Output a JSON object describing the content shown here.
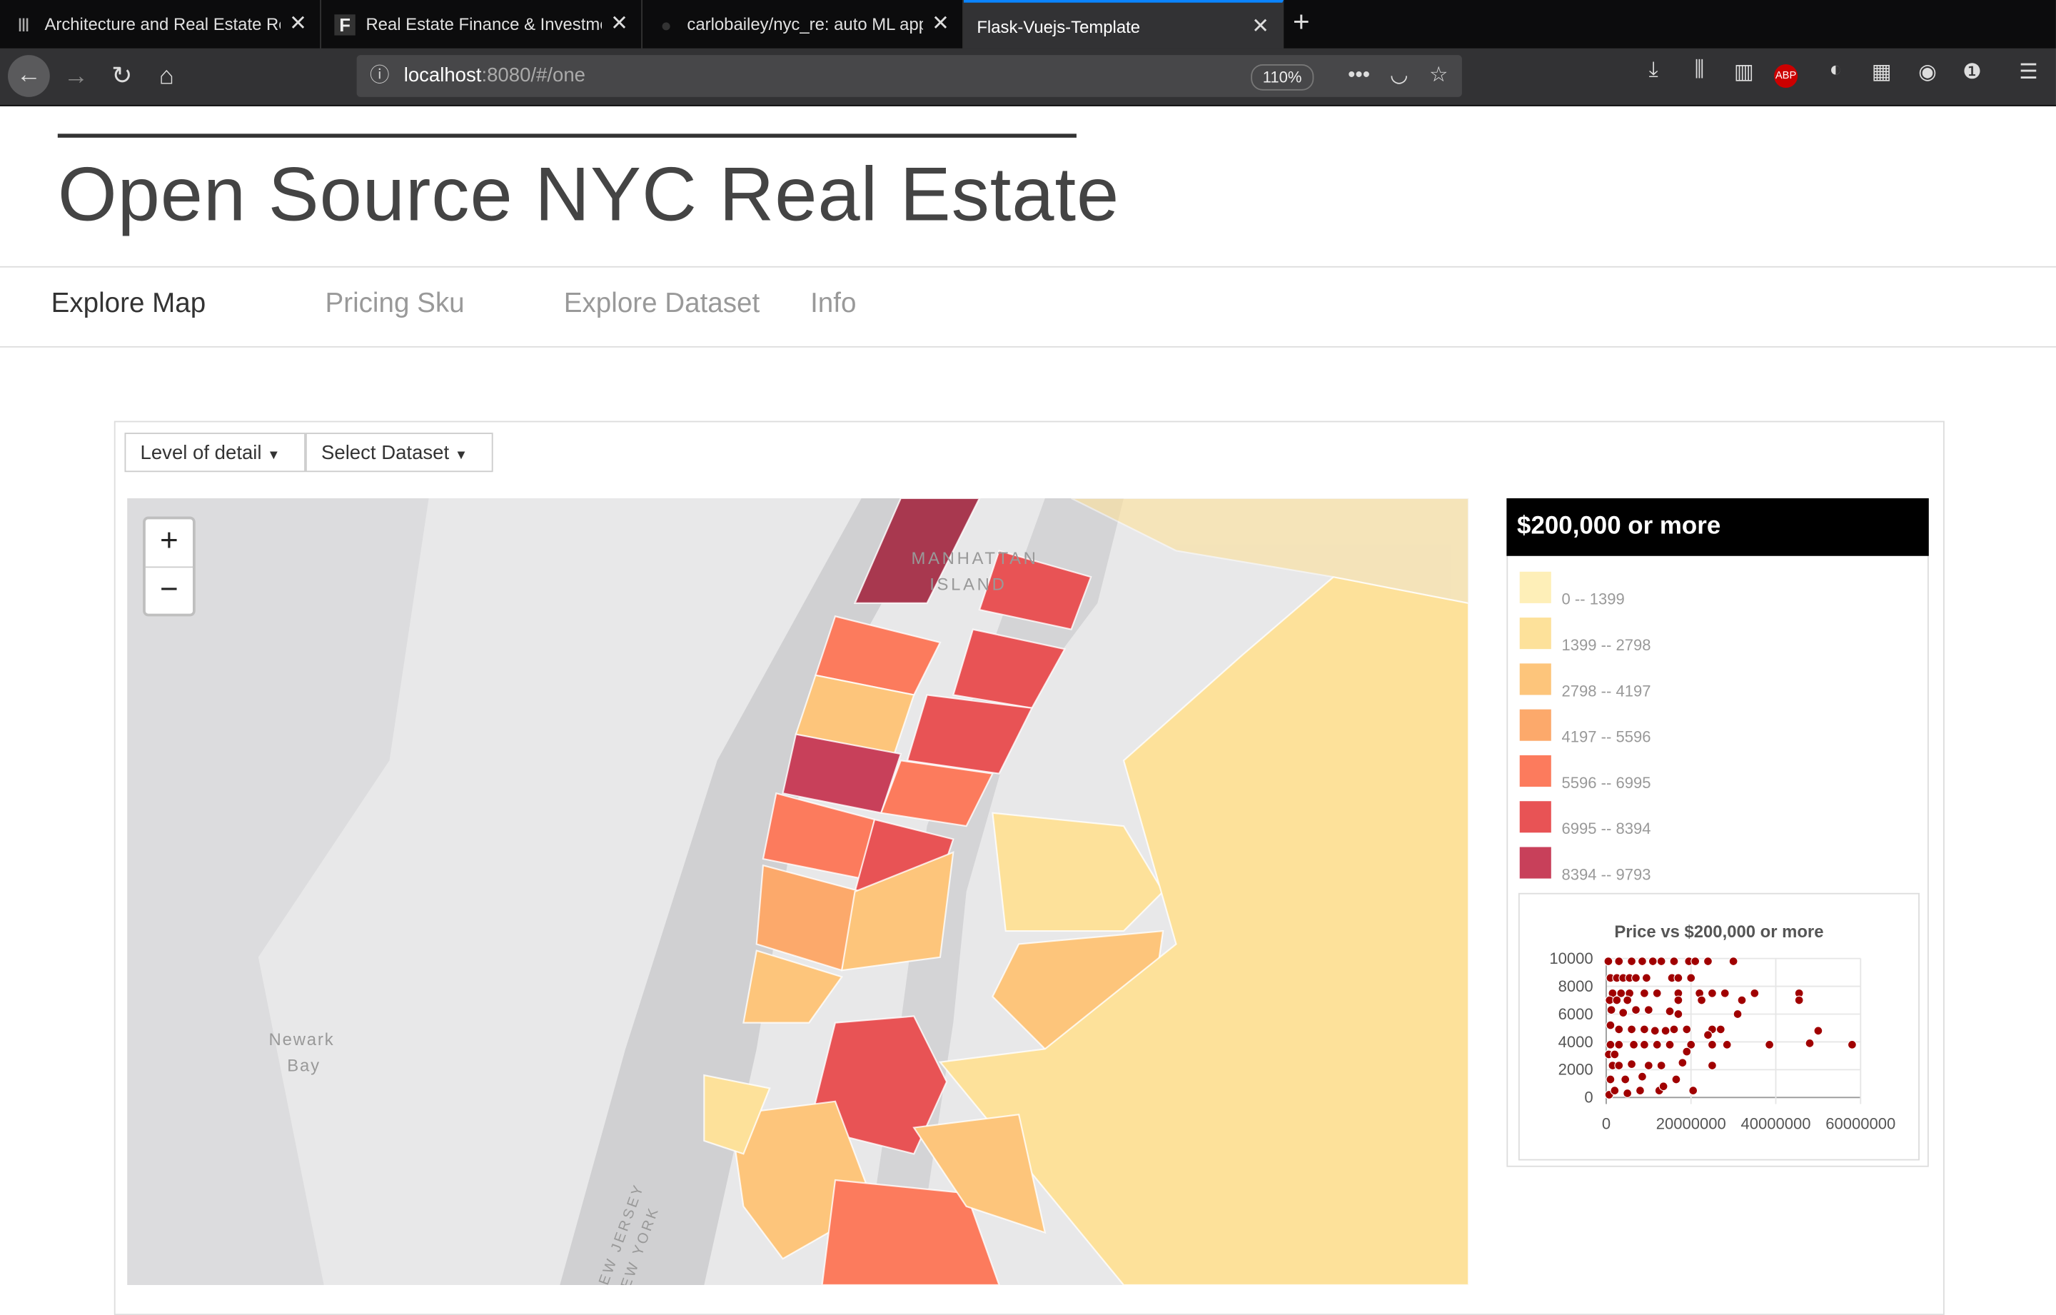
{
  "browser": {
    "tabs": [
      {
        "label": "Architecture and Real Estate Re",
        "icon": "hhh-icon"
      },
      {
        "label": "Real Estate Finance & Investme",
        "icon": "f-icon"
      },
      {
        "label": "carlobailey/nyc_re: auto ML app",
        "icon": "github-icon"
      },
      {
        "label": "Flask-Vuejs-Template",
        "icon": "none"
      }
    ],
    "url_host": "localhost",
    "url_rest": ":8080/#/one",
    "zoom": "110%"
  },
  "page": {
    "title": "Open Source NYC Real Estate",
    "nav": [
      "Explore Map",
      "Pricing Sku",
      "Explore Dataset",
      "Info"
    ],
    "dropdowns": [
      "Level of detail",
      "Select Dataset"
    ],
    "map_labels": {
      "manhattan1": "MANHATTAN",
      "manhattan2": "ISLAND",
      "newark1": "Newark",
      "newark2": "Bay",
      "nj": "NEW JERSEY",
      "ny": "NEW YORK"
    },
    "zoom_in": "+",
    "zoom_out": "−"
  },
  "legend": {
    "title": "$200,000 or more",
    "items": [
      {
        "label": "0 -- 1399",
        "color": "#feefb8"
      },
      {
        "label": "1399 -- 2798",
        "color": "#fde19a"
      },
      {
        "label": "2798 -- 4197",
        "color": "#fdc57b"
      },
      {
        "label": "4197 -- 5596",
        "color": "#fca96b"
      },
      {
        "label": "5596 -- 6995",
        "color": "#fc7b5d"
      },
      {
        "label": "6995 -- 8394",
        "color": "#e85355"
      },
      {
        "label": "8394 -- 9793",
        "color": "#c8405a"
      }
    ]
  },
  "chart_data": {
    "type": "scatter",
    "title": "Price vs $200,000 or more",
    "xlim": [
      0,
      60000000
    ],
    "ylim": [
      0,
      10000
    ],
    "xticks": [
      "0",
      "20000000",
      "40000000",
      "60000000"
    ],
    "yticks": [
      "0",
      "2000",
      "4000",
      "6000",
      "8000",
      "10000"
    ],
    "color": "#a00000",
    "points": [
      [
        500000,
        9800
      ],
      [
        3000000,
        9800
      ],
      [
        6000000,
        9800
      ],
      [
        8500000,
        9800
      ],
      [
        11000000,
        9800
      ],
      [
        13000000,
        9800
      ],
      [
        16000000,
        9800
      ],
      [
        19500000,
        9800
      ],
      [
        21000000,
        9800
      ],
      [
        24000000,
        9800
      ],
      [
        30000000,
        9800
      ],
      [
        1000000,
        8600
      ],
      [
        2500000,
        8600
      ],
      [
        4000000,
        8600
      ],
      [
        5500000,
        8600
      ],
      [
        7000000,
        8600
      ],
      [
        9500000,
        8600
      ],
      [
        15500000,
        8600
      ],
      [
        17000000,
        8600
      ],
      [
        20000000,
        8600
      ],
      [
        1500000,
        7500
      ],
      [
        3500000,
        7500
      ],
      [
        5500000,
        7500
      ],
      [
        9000000,
        7500
      ],
      [
        12000000,
        7500
      ],
      [
        17000000,
        7500
      ],
      [
        22000000,
        7500
      ],
      [
        25000000,
        7500
      ],
      [
        28000000,
        7500
      ],
      [
        35000000,
        7500
      ],
      [
        45500000,
        7500
      ],
      [
        800000,
        7000
      ],
      [
        2500000,
        7000
      ],
      [
        5000000,
        7000
      ],
      [
        17000000,
        7000
      ],
      [
        22500000,
        7000
      ],
      [
        32000000,
        7000
      ],
      [
        45500000,
        7000
      ],
      [
        1200000,
        6300
      ],
      [
        4000000,
        6100
      ],
      [
        7000000,
        6300
      ],
      [
        10000000,
        6300
      ],
      [
        15000000,
        6200
      ],
      [
        17000000,
        6000
      ],
      [
        31000000,
        6000
      ],
      [
        1000000,
        5200
      ],
      [
        3000000,
        4900
      ],
      [
        6000000,
        4900
      ],
      [
        9000000,
        4900
      ],
      [
        11500000,
        4800
      ],
      [
        14000000,
        4800
      ],
      [
        16000000,
        4900
      ],
      [
        19000000,
        4900
      ],
      [
        25000000,
        4900
      ],
      [
        27000000,
        4900
      ],
      [
        24000000,
        4500
      ],
      [
        50000000,
        4800
      ],
      [
        1000000,
        3800
      ],
      [
        3000000,
        3800
      ],
      [
        6500000,
        3800
      ],
      [
        9000000,
        3800
      ],
      [
        12000000,
        3800
      ],
      [
        15000000,
        3800
      ],
      [
        20000000,
        3800
      ],
      [
        25000000,
        3800
      ],
      [
        28500000,
        3800
      ],
      [
        38500000,
        3800
      ],
      [
        48000000,
        3900
      ],
      [
        58000000,
        3800
      ],
      [
        600000,
        3100
      ],
      [
        2000000,
        3100
      ],
      [
        19000000,
        3300
      ],
      [
        1500000,
        2300
      ],
      [
        3000000,
        2300
      ],
      [
        6000000,
        2400
      ],
      [
        10000000,
        2300
      ],
      [
        13000000,
        2300
      ],
      [
        18000000,
        2500
      ],
      [
        25000000,
        2300
      ],
      [
        1000000,
        1300
      ],
      [
        4500000,
        1300
      ],
      [
        8500000,
        1500
      ],
      [
        16500000,
        1300
      ],
      [
        700000,
        200
      ],
      [
        2000000,
        500
      ],
      [
        5000000,
        300
      ],
      [
        8000000,
        500
      ],
      [
        12500000,
        500
      ],
      [
        13500000,
        800
      ],
      [
        20500000,
        500
      ]
    ]
  }
}
